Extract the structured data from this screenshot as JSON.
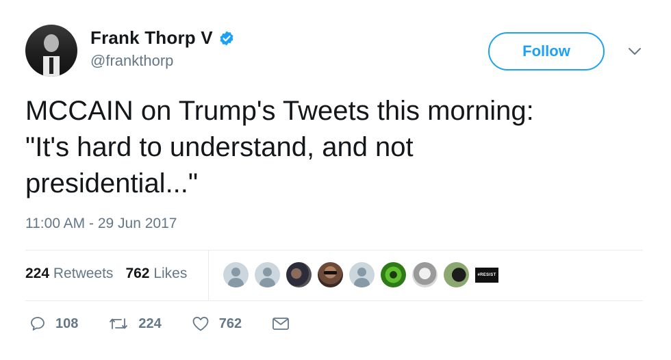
{
  "author": {
    "name": "Frank Thorp V",
    "handle": "@frankthorp",
    "verified": true
  },
  "follow_button": {
    "label": "Follow"
  },
  "tweet": {
    "lines": [
      "MCCAIN on Trump's Tweets this morning:",
      "\"It's hard to understand, and not",
      "presidential...\""
    ],
    "timestamp": "11:00 AM - 29 Jun 2017"
  },
  "stats": {
    "retweets_count": "224",
    "retweets_label": "Retweets",
    "likes_count": "762",
    "likes_label": "Likes"
  },
  "liker_avatars": [
    "default-avatar",
    "default-avatar",
    "photo-avatar",
    "sunglasses-avatar",
    "default-avatar",
    "green-eye-avatar",
    "bw-portrait-avatar",
    "profile-avatar",
    "resist-avatar"
  ],
  "resist_text": "#RESIST",
  "actions": {
    "replies": "108",
    "retweets": "224",
    "likes": "762"
  },
  "colors": {
    "accent": "#1da1f2",
    "muted": "#657786",
    "text": "#14171a",
    "divider": "#e6ecf0"
  }
}
